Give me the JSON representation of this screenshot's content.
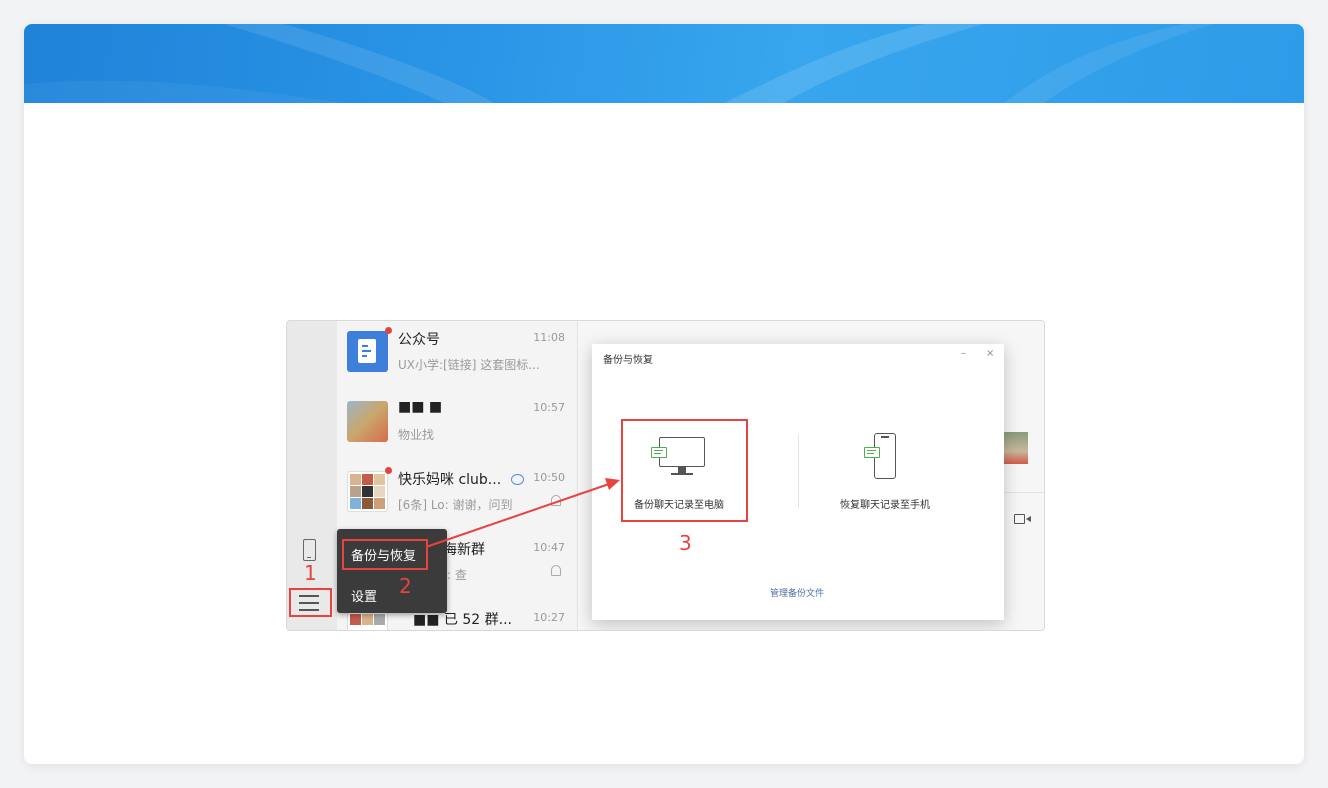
{
  "wechat": {
    "chats": [
      {
        "name": "公众号",
        "time": "11:08",
        "preview": "UX小学:[链接] 这套图标..."
      },
      {
        "name": "■■ ■",
        "time": "10:57",
        "preview": "物业找"
      },
      {
        "name": "快乐妈咪 club...",
        "time": "10:50",
        "preview": "[6条] Lo: 谢谢，问到"
      },
      {
        "name": "海新群",
        "time": "10:47",
        "preview": ": 查"
      },
      {
        "name": "■■ 已 52 群...",
        "time": "10:27",
        "preview": ""
      }
    ],
    "menu": {
      "backup_label": "备份与恢复",
      "settings_label": "设置"
    }
  },
  "dialog": {
    "title": "备份与恢复",
    "minimize": "–",
    "close": "×",
    "backup_to_pc": "备份聊天记录至电脑",
    "restore_to_phone": "恢复聊天记录至手机",
    "manage_files": "管理备份文件"
  },
  "annotations": {
    "step1": "1",
    "step2": "2",
    "step3": "3"
  },
  "colors": {
    "annotation_red": "#e8433e",
    "banner_blue": "#2a95e6",
    "menu_bg": "#3b3b3b",
    "link_blue": "#4c6ea8"
  }
}
